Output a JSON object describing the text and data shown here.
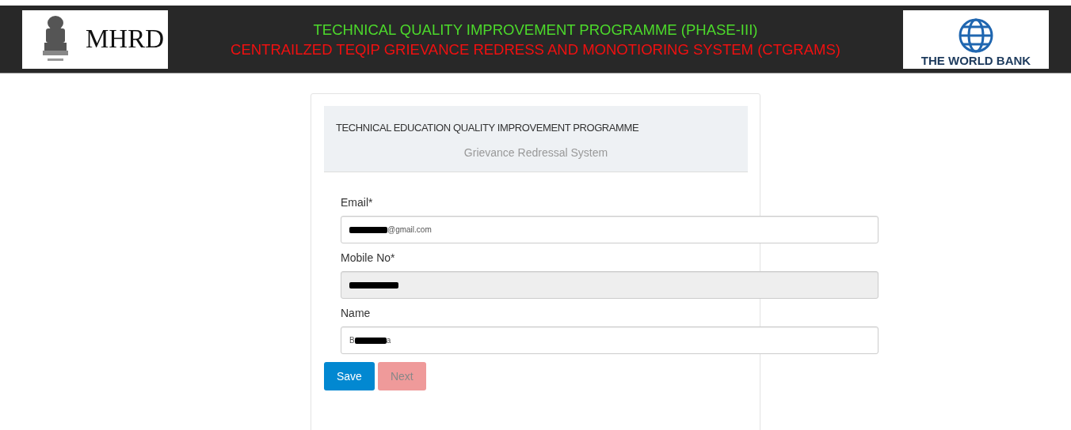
{
  "header": {
    "left_logo": {
      "text": "MHRD"
    },
    "title_lines": [
      {
        "text": "TECHNICAL QUALITY IMPROVEMENT PROGRAMME (PHASE-III)",
        "color": "#4cd92b"
      },
      {
        "text": "CENTRAILZED TEQIP GRIEVANCE REDRESS AND MONOTIORING SYSTEM (CTGRAMS)",
        "color": "#f01010"
      }
    ],
    "right_logo": {
      "text": "THE WORLD BANK"
    }
  },
  "panel": {
    "title": "TECHNICAL EDUCATION QUALITY IMPROVEMENT PROGRAMME",
    "subtitle": "Grievance Redressal System"
  },
  "fields": [
    {
      "label": "Email*",
      "suffix": "@gmail.com",
      "redacted": true,
      "disabled": false
    },
    {
      "label": "Mobile No*",
      "redacted": true,
      "disabled": true
    },
    {
      "label": "Name",
      "prefix": "B",
      "suffix": "a",
      "redacted": true,
      "disabled": false
    }
  ],
  "buttons": [
    {
      "label": "Save",
      "kind": "primary",
      "disabled": false
    },
    {
      "label": "Next",
      "kind": "danger",
      "disabled": true
    }
  ]
}
